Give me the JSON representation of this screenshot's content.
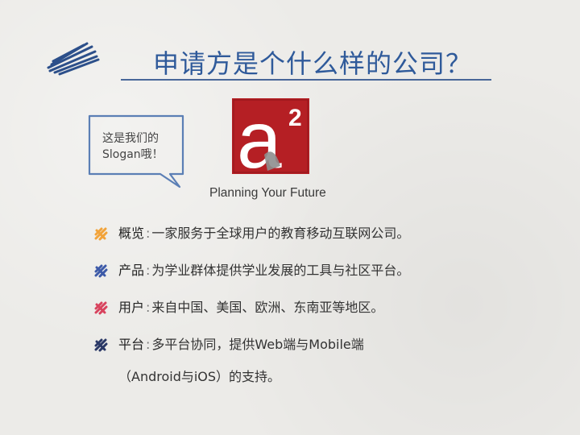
{
  "title": "申请方是个什么样的公司？",
  "bubble": {
    "line1": "这是我们的",
    "line2": "Slogan哦！"
  },
  "logo": {
    "letter": "a",
    "superscript": "2",
    "bg_color": "#b51f24"
  },
  "tagline": "Planning Your Future",
  "bullets": [
    {
      "label": "概览",
      "text": "一家服务于全球用户的教育移动互联网公司。",
      "marker_color": "#f2a33a"
    },
    {
      "label": "产品",
      "text": "为学业群体提供学业发展的工具与社区平台。",
      "marker_color": "#3d5aa8"
    },
    {
      "label": "用户",
      "text": "来自中国、美国、欧洲、东南亚等地区。",
      "marker_color": "#d8435e"
    },
    {
      "label": "平台",
      "text": "多平台协同，提供Web端与Mobile端",
      "text2": "（Android与iOS）的支持。",
      "marker_color": "#2a3866"
    }
  ],
  "colors": {
    "title": "#2f5a9a",
    "scribble": "#2c4f8a"
  }
}
